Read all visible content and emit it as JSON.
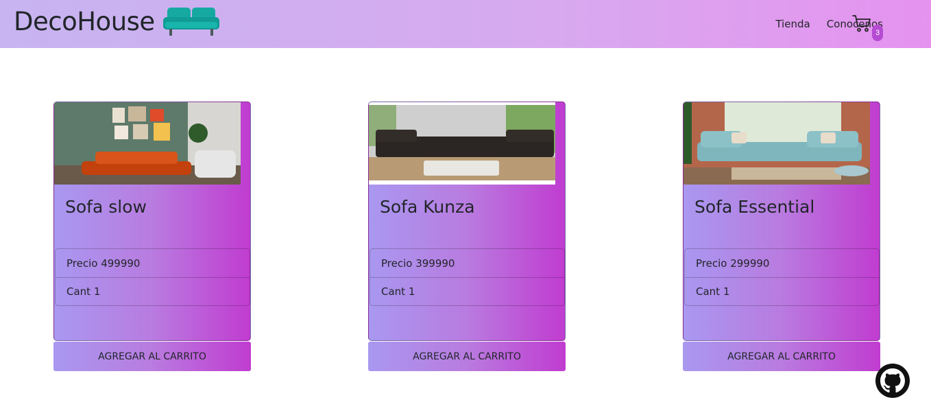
{
  "header": {
    "brand": "DecoHouse",
    "logo_icon": "sofa-icon",
    "nav": [
      {
        "label": "Tienda"
      },
      {
        "label": "Conocenos"
      }
    ],
    "cart": {
      "icon": "cart-icon",
      "count": "3"
    }
  },
  "products": [
    {
      "name": "Sofa slow",
      "price_label": "Precio 499990",
      "qty_label": "Cant 1",
      "button": "AGREGAR AL CARRITO",
      "image": "living-room-orange-sofa"
    },
    {
      "name": "Sofa Kunza",
      "price_label": "Precio 399990",
      "qty_label": "Cant 1",
      "button": "AGREGAR AL CARRITO",
      "image": "black-sectional-sofa"
    },
    {
      "name": "Sofa Essential",
      "price_label": "Precio 299990",
      "qty_label": "Cant 1",
      "button": "AGREGAR AL CARRITO",
      "image": "light-blue-sectional-sofa"
    }
  ],
  "footer": {
    "github_icon": "github-icon"
  },
  "colors": {
    "nav_gradient_start": "#c7b4f0",
    "nav_gradient_end": "#e593ef",
    "card_gradient_start": "#a998f0",
    "card_gradient_end": "#c03cd0",
    "badge": "#b54bd2"
  }
}
